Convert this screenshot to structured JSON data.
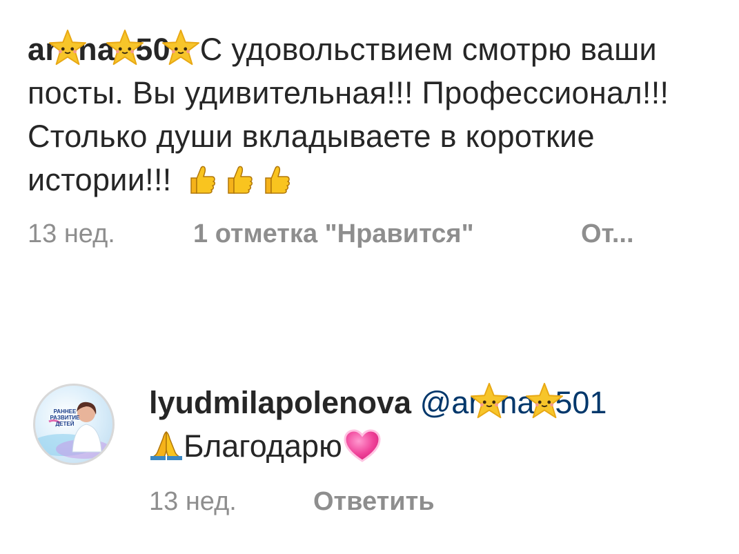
{
  "comment": {
    "username_fragments": [
      "ar",
      "na",
      "50"
    ],
    "text_line1": "С удовольствием",
    "text_rest": "смотрю ваши посты. Вы удивительная!!! Профессионал!!! Столько души вкладываете в короткие истории!!!",
    "emoji": [
      "star-sticker",
      "thumbs-up"
    ],
    "age": "13 нед.",
    "likes": "1 отметка \"Нравится\"",
    "reply": "От..."
  },
  "reply": {
    "avatar_caption": "РАННЕЕ РАЗВИТИЕ ДЕТЕЙ",
    "username": "lyudmilapolenova",
    "mention_fragments": [
      "@ar",
      "na",
      "501"
    ],
    "text": "Благодарю",
    "emoji": [
      "folded-hands",
      "sparkling-heart"
    ],
    "age": "13 нед.",
    "answer": "Ответить"
  },
  "colors": {
    "text": "#262626",
    "secondary": "#8e8e8e",
    "mention": "#00376b",
    "star": "#f7c52a"
  }
}
